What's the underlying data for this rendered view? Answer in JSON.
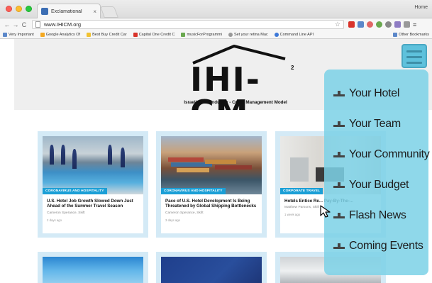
{
  "browser": {
    "tab_title": "Exclamational",
    "tab_close": "×",
    "profile_name": "Home",
    "url": "www.IHICM.org",
    "bookmarks": [
      {
        "label": "Very Important",
        "color": "#5b87c9"
      },
      {
        "label": "Google Analytics Of",
        "color": "#f4a821"
      },
      {
        "label": "Best Buy Credit Car",
        "color": "#f1c232"
      },
      {
        "label": "Capital One Credit C",
        "color": "#d9342b"
      },
      {
        "label": "musicForProgrammi",
        "color": "#6aa84f"
      },
      {
        "label": "Set your retina Mac",
        "color": "#999999"
      },
      {
        "label": "Command Line API",
        "color": "#3c78d8"
      }
    ],
    "other_bookmarks": "Other Bookmarks"
  },
  "site": {
    "logo_text": "IHI-CM",
    "logo_sup": "2",
    "tagline": "Israeli Hotel Industry - Crisis Management Model"
  },
  "articles": [
    {
      "tag": "CORONAVIRUS AND HOSPITALITY",
      "title": "U.S. Hotel Job Growth Slowed Down Just Ahead of the Summer Travel Season",
      "author": "Cameron Sperance, Skift",
      "time": "2 days ago"
    },
    {
      "tag": "CORONAVIRUS AND HOSPITALITY",
      "title": "Pace of U.S. Hotel Development Is Being Threatened by Global Shipping Bottlenecks",
      "author": "Cameron Sperance, Skift",
      "time": "3 days ago"
    },
    {
      "tag": "CORPORATE TRAVEL",
      "title": "Hotels Entice Re... Pay-By-The-...",
      "author": "Matthew Parsons, Skift",
      "time": "1 week ago"
    }
  ],
  "menu": [
    {
      "label": "Your Hotel"
    },
    {
      "label": "Your Team"
    },
    {
      "label": "Your Community"
    },
    {
      "label": "Your Budget"
    },
    {
      "label": "Flash News"
    },
    {
      "label": "Coming Events"
    }
  ],
  "colors": {
    "accent": "#1b9fd6",
    "menu_bg": "#7dd2e6",
    "card_bg": "#d4eaf6"
  }
}
